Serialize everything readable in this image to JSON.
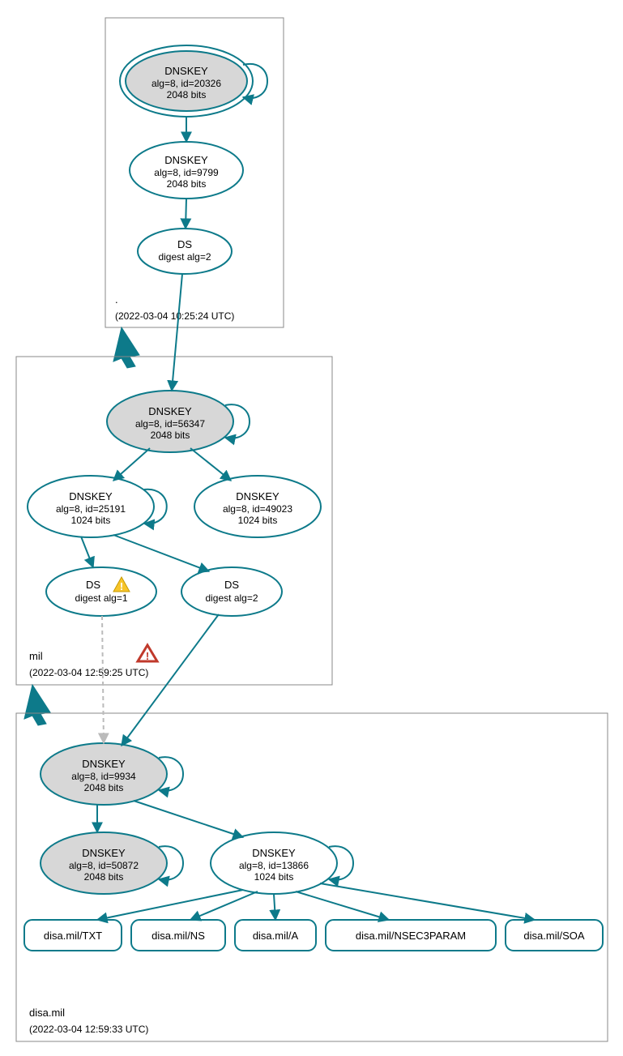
{
  "zones": {
    "root": {
      "label": ".",
      "timestamp": "(2022-03-04 10:25:24 UTC)"
    },
    "mil": {
      "label": "mil",
      "timestamp": "(2022-03-04 12:59:25 UTC)"
    },
    "disa": {
      "label": "disa.mil",
      "timestamp": "(2022-03-04 12:59:33 UTC)"
    }
  },
  "nodes": {
    "root_ksk": {
      "title": "DNSKEY",
      "line2": "alg=8, id=20326",
      "line3": "2048 bits"
    },
    "root_zsk": {
      "title": "DNSKEY",
      "line2": "alg=8, id=9799",
      "line3": "2048 bits"
    },
    "root_ds": {
      "title": "DS",
      "line2": "digest alg=2"
    },
    "mil_ksk": {
      "title": "DNSKEY",
      "line2": "alg=8, id=56347",
      "line3": "2048 bits"
    },
    "mil_zsk_l": {
      "title": "DNSKEY",
      "line2": "alg=8, id=25191",
      "line3": "1024 bits"
    },
    "mil_zsk_r": {
      "title": "DNSKEY",
      "line2": "alg=8, id=49023",
      "line3": "1024 bits"
    },
    "mil_ds1": {
      "title": "DS",
      "line2": "digest alg=1"
    },
    "mil_ds2": {
      "title": "DS",
      "line2": "digest alg=2"
    },
    "disa_ksk": {
      "title": "DNSKEY",
      "line2": "alg=8, id=9934",
      "line3": "2048 bits"
    },
    "disa_ksk2": {
      "title": "DNSKEY",
      "line2": "alg=8, id=50872",
      "line3": "2048 bits"
    },
    "disa_zsk": {
      "title": "DNSKEY",
      "line2": "alg=8, id=13866",
      "line3": "1024 bits"
    }
  },
  "rrsets": {
    "txt": "disa.mil/TXT",
    "ns": "disa.mil/NS",
    "a": "disa.mil/A",
    "n3p": "disa.mil/NSEC3PARAM",
    "soa": "disa.mil/SOA"
  }
}
